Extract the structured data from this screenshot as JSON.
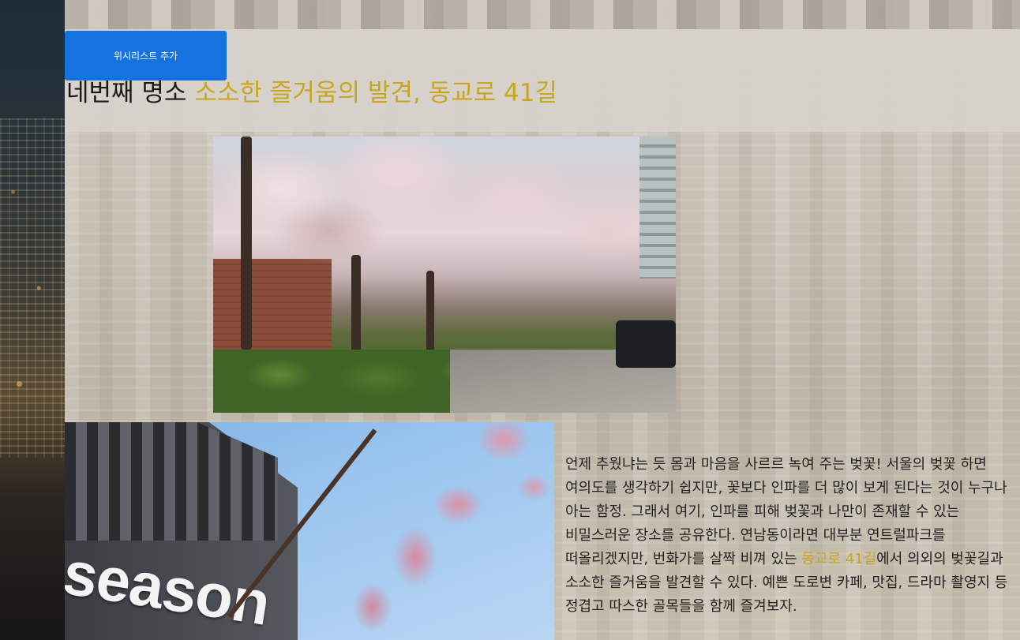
{
  "wishlist_button": {
    "label": "위시리스트 추가"
  },
  "title": {
    "prefix": "네번째 명소",
    "highlight": "소소한 즐거움의 발견, 동교로 41길"
  },
  "images": [
    {
      "name": "cherry-blossom-street-photo",
      "alt": "동교로 41길 벚꽃길"
    },
    {
      "name": "season-building-photo",
      "alt": "season",
      "sign_text": "season"
    }
  ],
  "description": {
    "part1": "언제 추웠냐는 듯 몸과 마음을 사르르 녹여 주는 벚꽃! 서울의 벚꽃 하면 여의도를 생각하기 쉽지만, 꽃보다 인파를 더 많이 보게 된다는 것이 누구나 아는 함정. 그래서 여기, 인파를 피해 벚꽃과 나만이 존재할 수 있는 비밀스러운 장소를 공유한다. 연남동이라면 대부분 연트럴파크를 떠올리겠지만, 번화가를 살짝 비껴 있는 ",
    "highlight": "동교로 41길",
    "part2": "에서 의외의 벚꽃길과 소소한 즐거움을 발견할 수 있다. 예쁜 도로변 카페, 맛집, 드라마 촬영지 등 정겹고 따스한 골목들을 함께 즐겨보자."
  },
  "colors": {
    "accent_gold": "#c9a61b",
    "button_blue": "#1573e0"
  }
}
